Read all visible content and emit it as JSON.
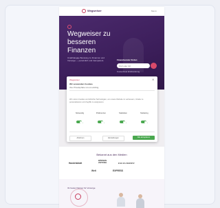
{
  "header": {
    "logo": "Wegweiser",
    "menu": "Menü"
  },
  "hero": {
    "title": "Wegweiser zu besseren Finanzen",
    "subtitle": "Unabhängige Beratung zu Finanzen und Vorsorge — persönlich und transparent.",
    "search_label": "Finanzberater finden",
    "search_placeholder": "PLZ oder Ort",
    "search_note": "Kostenfreie Erstberatung"
  },
  "cookie_modal": {
    "brand": "Wegweiser",
    "title": "Wir verwenden Cookies",
    "subtitle": "Ihre Privatsphäre ist uns wichtig",
    "body": "Wir nutzen Cookies und ähnliche Technologien, um unsere Website zu verbessern, Inhalte zu personalisieren und Zugriffe zu analysieren.",
    "categories": [
      "Notwendig",
      "Präferenzen",
      "Statistiken",
      "Marketing"
    ],
    "buttons": {
      "reject": "Ablehnen",
      "settings": "Einstellungen",
      "accept": "Alle akzeptieren"
    }
  },
  "press": {
    "title": "Bekannt aus den Medien",
    "logos": [
      "Handelsblatt",
      "BÖRSEN ZEITUNG",
      "FOCUS MONEY",
      "Welt",
      "EXPRESS"
    ]
  },
  "lower": {
    "title": "Ihr bester Partner für Vorsorge"
  },
  "colors": {
    "hero": "#3d1f5c",
    "accent": "#c73a5a",
    "accept": "#4aa84f"
  }
}
